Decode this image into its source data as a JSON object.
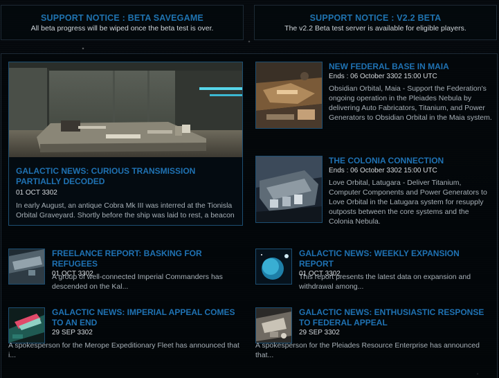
{
  "notices": [
    {
      "title": "SUPPORT NOTICE : BETA SAVEGAME",
      "text": "All beta progress will be wiped once the beta test is over."
    },
    {
      "title": "SUPPORT NOTICE : V2.2 BETA",
      "text": "The v2.2 Beta test server is available for eligible players."
    }
  ],
  "featured": {
    "title": "GALACTIC NEWS: CURIOUS TRANSMISSION PARTIALLY DECODED",
    "date": "01 OCT 3302",
    "body": "In early August, an antique Cobra Mk III was interred at the Tionisla Orbital Graveyard. Shortly before the ship was laid to rest, a beacon aboard the..."
  },
  "goals": [
    {
      "title": "NEW FEDERAL BASE IN MAIA",
      "ends": "Ends : 06 October 3302 15:00 UTC",
      "body": "Obsidian Orbital, Maia - Support the Federation's ongoing operation in the Pleiades Nebula by delivering Auto Fabricators, Titanium, and Power Generators to Obsidian Orbital in the Maia system."
    },
    {
      "title": "THE COLONIA CONNECTION",
      "ends": "Ends : 06 October 3302 15:00 UTC",
      "body": "Love Orbital, Latugara - Deliver Titanium, Computer Components and Power Generators to Love Orbital in the Latugara system for resupply outposts between the core systems and the Colonia Nebula."
    }
  ],
  "news": [
    {
      "title": "FREELANCE REPORT: BASKING FOR REFUGEES",
      "date": "01 OCT 3302",
      "body": "A group of well-connected Imperial Commanders has descended on the Kal..."
    },
    {
      "title": "GALACTIC NEWS: WEEKLY EXPANSION REPORT",
      "date": "01 OCT 3302",
      "body": "This report presents the latest data on expansion and withdrawal among..."
    },
    {
      "title": "GALACTIC NEWS: IMPERIAL APPEAL COMES TO AN END",
      "date": "29 SEP 3302",
      "body": "A spokesperson for the Merope Expeditionary Fleet has announced that i..."
    },
    {
      "title": "GALACTIC NEWS: ENTHUSIASTIC RESPONSE TO FEDERAL APPEAL",
      "date": "29 SEP 3302",
      "body": "A spokesperson for the Pleiades Resource Enterprise has announced that..."
    }
  ],
  "colors": {
    "link": "#1f72b3",
    "border": "#1d4f73",
    "background": "#030609"
  }
}
